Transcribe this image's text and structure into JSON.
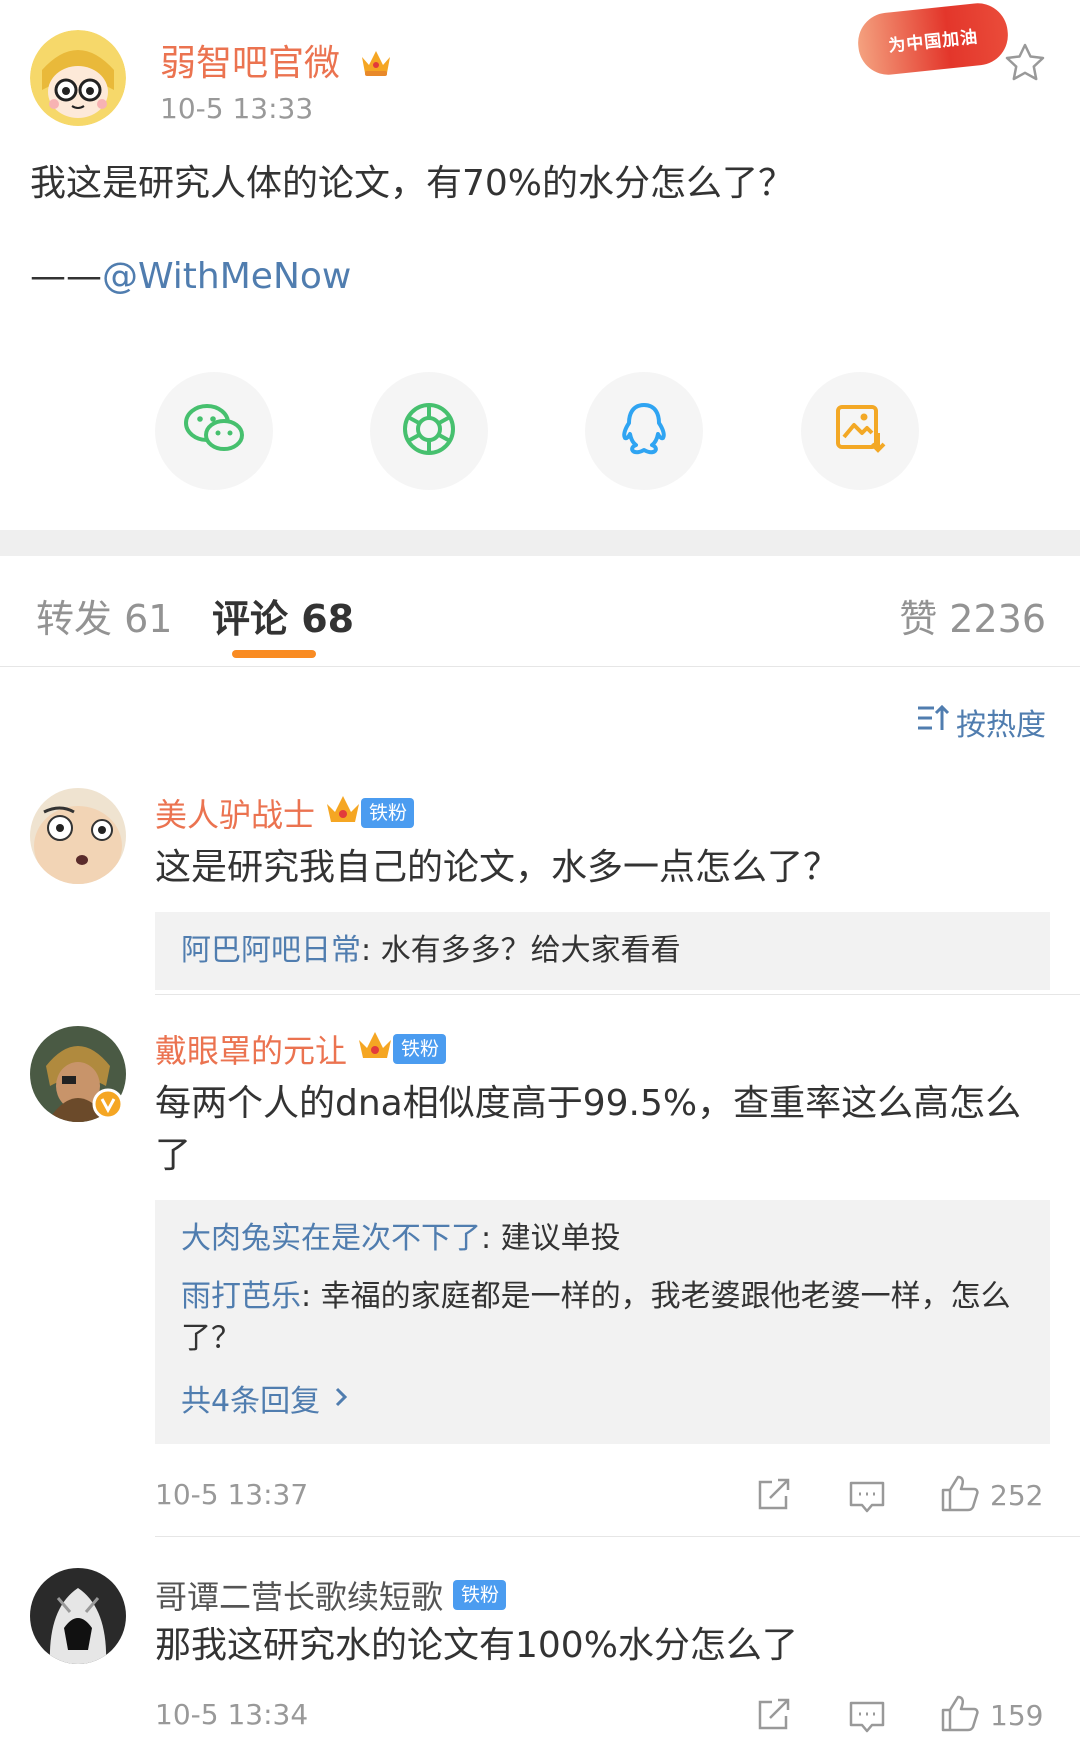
{
  "post": {
    "author": "弱智吧官微",
    "time": "10-5 13:33",
    "promo_badge": "为中国加油",
    "text": "我这是研究人体的论文，有70%的水分怎么了？",
    "signature_dash": "——",
    "signature_handle": "@WithMeNow",
    "share_icons": [
      "wechat-icon",
      "moments-icon",
      "qq-icon",
      "save-image-icon"
    ]
  },
  "tabs": {
    "repost": "转发 61",
    "comment": "评论 68",
    "like": "赞 2236"
  },
  "sort": {
    "label": "按热度"
  },
  "comments": [
    {
      "user": "美人驴战士",
      "badge": "铁粉",
      "text": "这是研究我自己的论文，水多一点怎么了？",
      "replies": [
        {
          "user": "阿巴阿吧日常",
          "text": ": 水有多多？给大家看看"
        }
      ]
    },
    {
      "user": "戴眼罩的元让",
      "badge": "铁粉",
      "text": "每两个人的dna相似度高于99.5%，查重率这么高怎么了",
      "replies": [
        {
          "user": "大肉兔实在是次不下了",
          "text": ": 建议单投"
        },
        {
          "user": "雨打芭乐",
          "text": ": 幸福的家庭都是一样的，我老婆跟他老婆一样，怎么了？"
        }
      ],
      "more_replies": "共4条回复",
      "time": "10-5 13:37",
      "likes": "252"
    },
    {
      "user": "哥谭二营长歌续短歌",
      "badge": "铁粉",
      "text": "那我这研究水的论文有100%水分怎么了",
      "time": "10-5 13:34",
      "likes": "159"
    }
  ],
  "colors": {
    "accent_orange": "#eb7350",
    "link_blue": "#507daf",
    "tab_underline": "#f98b22",
    "badge_blue": "#4b9cf0"
  }
}
